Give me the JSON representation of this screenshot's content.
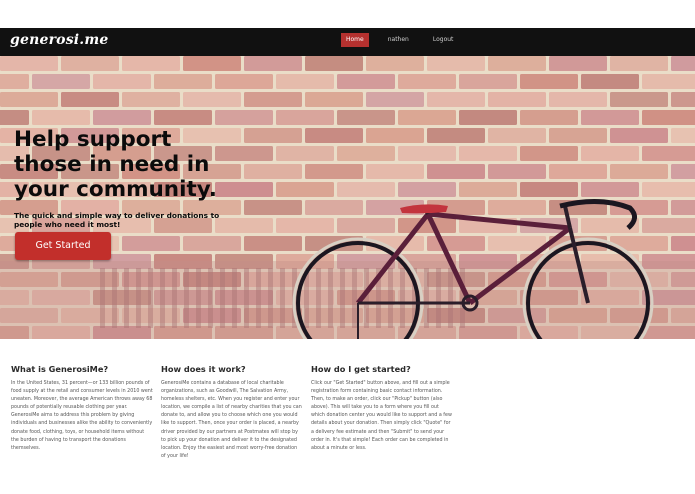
{
  "brand": "generosi.me",
  "nav": {
    "items": [
      {
        "label": "Home",
        "active": true
      },
      {
        "label": "nathen",
        "active": false
      },
      {
        "label": "Logout",
        "active": false
      }
    ]
  },
  "hero": {
    "title": "Help support those in need in your community.",
    "subtitle": "The quick and simple way to deliver donations to people who need it most!",
    "cta_label": "Get Started"
  },
  "columns": [
    {
      "heading": "What is GenerosiMe?",
      "body": "In the United States, 31 percent—or 133 billion pounds of food supply at the retail and consumer levels in 2010 went uneaten. Moreover, the average American throws away 68 pounds of potentially reusable clothing per year. GenerosiMe aims to address this problem by giving individuals and businesses alike the ability to conveniently donate food, clothing, toys, or household items without the burden of having to transport the donations themselves."
    },
    {
      "heading": "How does it work?",
      "body": "GenerosiMe contains a database of local charitable organizations, such as Goodwill, The Salvation Army, homeless shelters, etc. When you register and enter your location, we compile a list of nearby charities that you can donate to, and allow you to choose which one you would like to support. Then, once your order is placed, a nearby driver provided by our partners at Postmates will stop by to pick up your donation and deliver it to the designated location. Enjoy the easiest and most worry-free donation of your life!"
    },
    {
      "heading": "How do I get started?",
      "body": "Click our \"Get Started\" button above, and fill out a simple registration form containing basic contact information. Then, to make an order, click our \"Pickup\" button (also above). This will take you to a form where you fill out which donation center you would like to support and a few details about your donation. Then simply click \"Quote\" for a delivery fee estimate and then \"Submit\" to send your order in. It's that simple! Each order can be completed in about a minute or less."
    }
  ],
  "colors": {
    "navbar": "#111111",
    "accent": "#c22f2b",
    "brick": "#c9857a",
    "mortar": "#e8dcc6"
  },
  "icons": [
    "bicycle-illustration"
  ]
}
